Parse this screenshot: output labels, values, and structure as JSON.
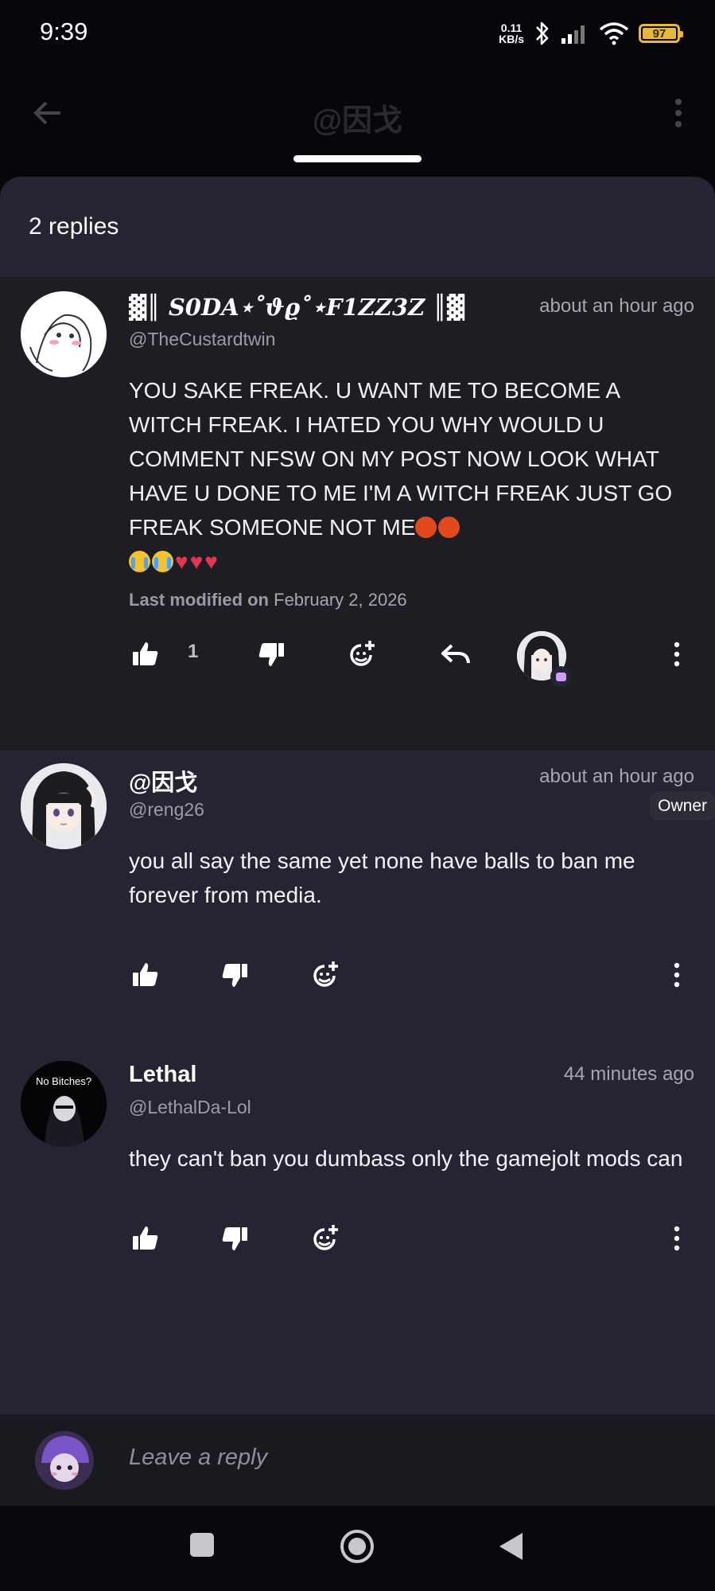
{
  "status_bar": {
    "time": "9:39",
    "net_speed_value": "0.11",
    "net_speed_unit": "KB/s",
    "battery_level": "97",
    "icons": [
      "bluetooth-icon",
      "signal-icon",
      "wifi-icon",
      "battery-icon"
    ]
  },
  "header": {
    "title": "@因戈"
  },
  "sheet": {
    "replies_count": "2 replies"
  },
  "comments": [
    {
      "author": "▓║ S0DA⋆˚ϑϱ˚⋆F1ZZ3Z ║▓",
      "handle": "@TheCustardtwin",
      "time": "about an hour ago",
      "body": "YOU SAKE FREAK. U WANT ME TO BECOME A WITCH FREAK. I HATED YOU WHY WOULD U COMMENT NFSW ON MY POST NOW LOOK WHAT HAVE U DONE TO ME I'M A WITCH FREAK JUST GO FREAK SOMEONE NOT ME",
      "modified_label": "Last modified on",
      "modified_date": "February 2, 2026",
      "like_count": "1"
    },
    {
      "author": "@因戈",
      "handle": "@reng26",
      "time": "about an hour ago",
      "badge": "Owner",
      "body": "you all say the same yet none have balls to ban me forever from media."
    },
    {
      "author": "Lethal",
      "handle": "@LethalDa-Lol",
      "time": "44 minutes ago",
      "avatar_text": "No Bitches?",
      "body": "they can't ban you dumbass only the gamejolt mods can"
    }
  ],
  "reply_bar": {
    "placeholder": "Leave a reply"
  },
  "colors": {
    "sheet_bg": "#252433",
    "highlight_bg": "#1f1d24",
    "accent_badge": "#d59cff"
  }
}
